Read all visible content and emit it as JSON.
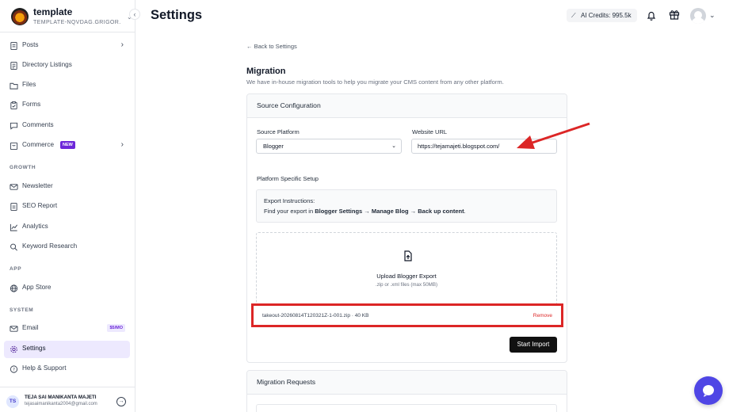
{
  "workspace": {
    "name": "template",
    "slug": "TEMPLATE-NQVDAG.GRIGOR..."
  },
  "sidebar": {
    "items": [
      {
        "key": "posts",
        "label": "Posts"
      },
      {
        "key": "directory",
        "label": "Directory Listings"
      },
      {
        "key": "files",
        "label": "Files"
      },
      {
        "key": "forms",
        "label": "Forms"
      },
      {
        "key": "comments",
        "label": "Comments"
      },
      {
        "key": "commerce",
        "label": "Commerce",
        "badge": "NEW"
      }
    ],
    "growth_label": "GROWTH",
    "growth_items": [
      {
        "label": "Newsletter"
      },
      {
        "label": "SEO Report"
      },
      {
        "label": "Analytics"
      },
      {
        "label": "Keyword Research"
      }
    ],
    "app_label": "APP",
    "app_items": [
      {
        "label": "App Store"
      }
    ],
    "system_label": "SYSTEM",
    "system_items": [
      {
        "label": "Email",
        "badge": "$5/MO"
      },
      {
        "label": "Settings"
      },
      {
        "label": "Help & Support"
      }
    ],
    "active_item": "Settings"
  },
  "user": {
    "initials": "TS",
    "name": "TEJA SAI MANIKANTA MAJETI",
    "email": "tejasaimanikanta2004@gmail.com"
  },
  "header": {
    "title": "Settings",
    "credits": "AI Credits: 995.5k"
  },
  "content": {
    "back_link": "← Back to Settings",
    "heading": "Migration",
    "subheading": "We have in-house migration tools to help you migrate your CMS content from any other platform.",
    "source_card": {
      "title": "Source Configuration",
      "platform_label": "Source Platform",
      "platform_value": "Blogger",
      "url_label": "Website URL",
      "url_value": "https://tejamajeti.blogspot.com/",
      "setup_label": "Platform Specific Setup",
      "instr_title": "Export Instructions:",
      "instr_prefix": "Find your export in ",
      "instr_step1": "Blogger Settings",
      "instr_arrow": " → ",
      "instr_step2": "Manage Blog",
      "instr_step3": "Back up content",
      "instr_suffix": ".",
      "upload_title": "Upload Blogger Export",
      "upload_hint": ".zip or .xml files (max 50MB)",
      "file_name": "takeout-20260814T120321Z-1-001.zip · 40 KB",
      "remove_label": "Remove",
      "import_label": "Start Import"
    },
    "requests_card": {
      "title": "Migration Requests"
    }
  },
  "colors": {
    "accent": "#6d28d9",
    "highlight": "#dc2626",
    "chat": "#4f46e5"
  }
}
